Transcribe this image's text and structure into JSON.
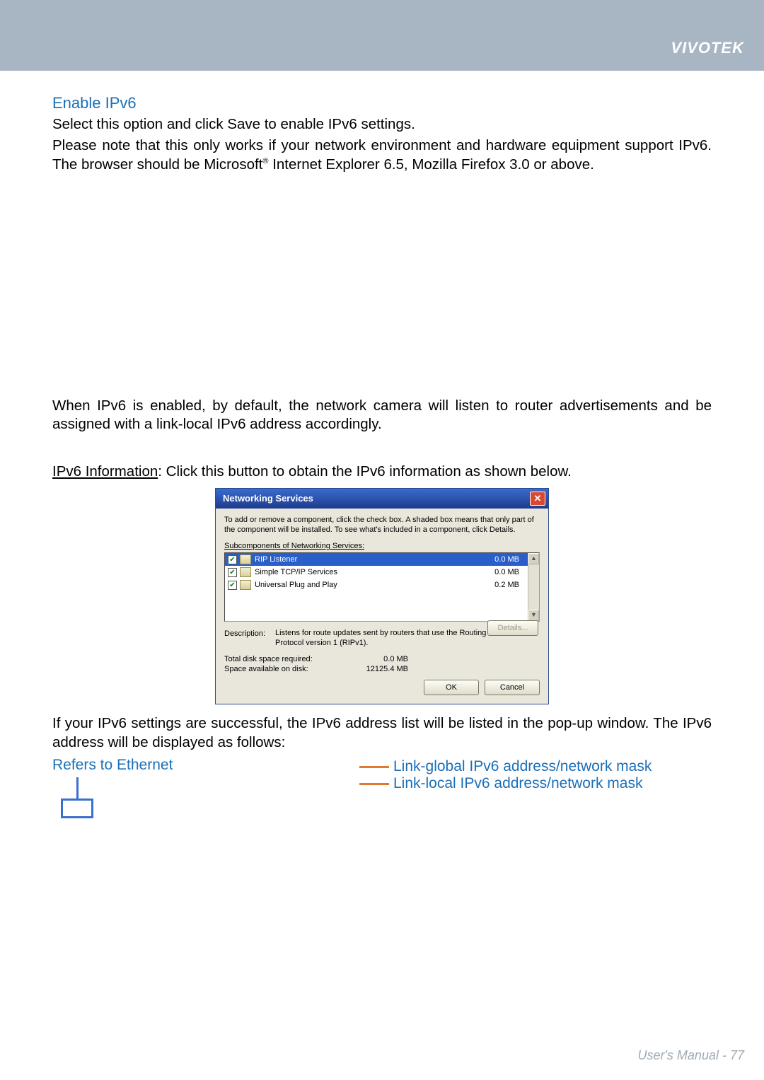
{
  "brand": "VIVOTEK",
  "heading_enable": "Enable IPv6",
  "p1": "Select this option and click Save to enable IPv6 settings.",
  "p2a": "Please note that this only works if your network environment and hardware equipment support IPv6. The browser should be Microsoft",
  "p2_reg": "®",
  "p2b": " Internet Explorer 6.5, Mozilla Firefox 3.0 or above.",
  "p3": "When IPv6 is enabled, by default, the network camera will listen to router advertisements and be assigned with a link-local IPv6 address accordingly.",
  "p4_label": "IPv6 Information",
  "p4_rest": ": Click this button to obtain the IPv6 information as shown below.",
  "dialog": {
    "title": "Networking Services",
    "note": "To add or remove a component, click the check box. A shaded box means that only part of the component will be installed. To see what's included in a component, click Details.",
    "caption": "Subcomponents of Networking Services:",
    "rows": [
      {
        "name": "RIP Listener",
        "size": "0.0 MB",
        "selected": true,
        "checked": true
      },
      {
        "name": "Simple TCP/IP Services",
        "size": "0.0 MB",
        "selected": false,
        "checked": true
      },
      {
        "name": "Universal Plug and Play",
        "size": "0.2 MB",
        "selected": false,
        "checked": true
      }
    ],
    "desc_label": "Description:",
    "desc_text": "Listens for route updates sent by routers that use the Routing Information Protocol version 1 (RIPv1).",
    "stat1_label": "Total disk space required:",
    "stat1_val": "0.0 MB",
    "stat2_label": "Space available on disk:",
    "stat2_val": "12125.4 MB",
    "details_btn": "Details...",
    "ok_btn": "OK",
    "cancel_btn": "Cancel"
  },
  "p5": "If your IPv6 settings are successful, the IPv6 address list will be listed in the pop-up window. The IPv6 address will be displayed as follows:",
  "eth_title": "Refers to Ethernet",
  "link_global": "Link-global IPv6 address/network mask",
  "link_local": "Link-local IPv6 address/network mask",
  "footer_label": "User's Manual - ",
  "footer_page": "77"
}
